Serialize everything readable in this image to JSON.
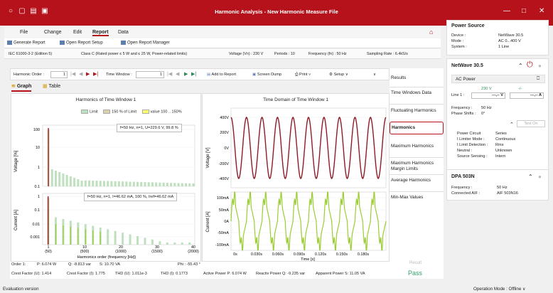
{
  "window": {
    "title": "Harmonic Analysis - New Harmonic Measure File",
    "minimize": "—",
    "maximize": "□",
    "close": "✕"
  },
  "menu": {
    "file": "File",
    "change": "Change",
    "edit": "Edit",
    "report": "Report",
    "data": "Data"
  },
  "toolbar": {
    "generate": "Generate Report",
    "open_setup": "Open Report Setup",
    "open_manager": "Open Report Manager"
  },
  "info": {
    "standard": "IEC 61000-3-2 (Edition 5)",
    "class": "Class C (Rated power ≤ 5 W and ≤ 25 W, Power-related limits)",
    "voltage": "Voltage (Vn) :   230 V",
    "periods": "Periods :   10",
    "frequency": "Frequency (fn) :   50 Hz",
    "sampling": "Sampling Rate :   6.4kS/s"
  },
  "controls": {
    "harmonic_order_label": "Harmonic Order :",
    "harmonic_order_value": "1",
    "time_window_label": "Time Window :",
    "time_window_value": "1",
    "add_to_report": "Add to Report",
    "screen_dump": "Screen Dump",
    "print": "Print ∨",
    "setup": "Setup ∨"
  },
  "tabs": {
    "graph": "Graph",
    "table": "Table"
  },
  "left_chart": {
    "title": "Harmonics of Time Window 1",
    "legend": [
      "Limit",
      "150 % of Limit",
      "value 100 .. 150%"
    ],
    "info_voltage": "f=50 Hz, n=1, U=229.6 V, 99.8 %",
    "info_current": "f=50 Hz, n=1, I=46.62 mA, 100 %, Iref=46.62 mA",
    "y_voltage": "Voltage [%]",
    "y_current": "Current [A]",
    "xlabel": "Harmonics order (frequency [Hz])",
    "v_ticks": [
      "100",
      "10",
      "1",
      "0.1"
    ],
    "i_ticks": [
      "1",
      "0.1",
      "0.01",
      "0.001"
    ],
    "x_ticks": [
      "1",
      "10",
      "20",
      "30",
      "40"
    ],
    "x_sub": [
      "(50)",
      "(500)",
      "(1000)",
      "(1500)",
      "(2000)"
    ]
  },
  "right_chart": {
    "title": "Time Domain of Time Window 1",
    "y_voltage": "Voltage [V]",
    "y_current": "Current [A]",
    "xlabel": "Time [s]",
    "v_ticks": [
      "400V",
      "200V",
      "0V",
      "-200V",
      "-400V"
    ],
    "i_ticks": [
      "100mA",
      "50mA",
      "0A",
      "-50mA",
      "-100mA"
    ],
    "x_ticks": [
      "0s",
      "0.030s",
      "0.060s",
      "0.090s",
      "0.120s",
      "0.150s",
      "0.180s"
    ]
  },
  "status": {
    "order": "Order 1:",
    "p": "P: 6.074 W",
    "q": "Q: -8.813 var",
    "s": "S: 10.70 VA",
    "phi": "Phi : -55.43 °",
    "crest_u": "Crest Factor (U):  1.414",
    "crest_i": "Crest Factor (I):  1.775",
    "thd_u": "THD (U):  1.011e-3",
    "thd_i": "THD (I):    0.1773",
    "active": "Active Power P:  6.074 W",
    "reactive": "Reactiv Power Q:  -9.235 var",
    "apparent": "Apparent Power S:   11.05 VA"
  },
  "result": {
    "label": "Result",
    "value": "Pass"
  },
  "side_list": [
    "Results",
    "Time Windows Data",
    "Fluctuating Harmonics",
    "Harmonics",
    "Maximum Harmonics",
    "Maximum Harmonics Margin Limits",
    "Average Harmonics",
    "Min-Max Values"
  ],
  "power_source": {
    "title": "Power Source",
    "device_label": "Device :",
    "device": "NetWave 30.5",
    "mode_label": "Mode :",
    "mode": "AC 0...400 V",
    "system_label": "System :",
    "system": "1 Line"
  },
  "netwave": {
    "title": "NetWave 30.5",
    "ac_power": "AC Power",
    "volt_set": "230 V",
    "volt_dash": "-/-",
    "line1": "Line 1 :",
    "v_read": "---,-- V",
    "a_read": "---,-- A",
    "freq_label": "Frequency :",
    "freq": "50 Hz",
    "phase_label": "Phase Shifts :",
    "phase": "0°",
    "test_on": "Test On",
    "pc_label": "Power Circuit",
    "pc": "Series",
    "ilim_label": "I Limiter Mode :",
    "ilim": "Continuous",
    "ildet_label": "I Limit Detection :",
    "ildet": "Rms",
    "neutral_label": "Neutral :",
    "neutral": "Unknown",
    "sense_label": "Source Sensing :",
    "sense": "Intern"
  },
  "dpa": {
    "title": "DPA 503N",
    "freq_label": "Frequency :",
    "freq": "50 Hz",
    "aif_label": "Connected AIF :",
    "aif": "AIF 503N16"
  },
  "footer": {
    "evaluation": "Evaluation version",
    "op_mode": "Operation Mode :  Offline ∨"
  },
  "colors": {
    "brand": "#b5121b",
    "pass": "#2e9e6e",
    "wave": "#8e1b26",
    "current": "#9acd32",
    "bar": "#bfe0bf"
  }
}
